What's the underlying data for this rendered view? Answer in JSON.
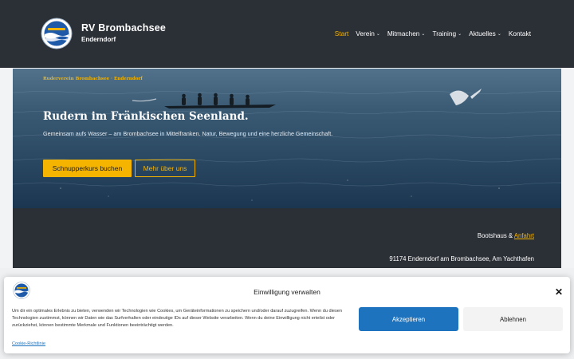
{
  "brand": {
    "name": "RV Brombachsee",
    "location": "Enderndorf"
  },
  "nav": {
    "items": [
      {
        "label": "Start",
        "active": true,
        "has_dropdown": false
      },
      {
        "label": "Verein",
        "active": false,
        "has_dropdown": true
      },
      {
        "label": "Mitmachen",
        "active": false,
        "has_dropdown": true
      },
      {
        "label": "Training",
        "active": false,
        "has_dropdown": true
      },
      {
        "label": "Aktuelles",
        "active": false,
        "has_dropdown": true
      },
      {
        "label": "Kontakt",
        "active": false,
        "has_dropdown": false
      }
    ]
  },
  "hero": {
    "kicker": "Ruderverein Brombachsee · Enderndorf",
    "title": "Rudern im Fränkischen Seenland.",
    "text": "Gemeinsam aufs Wasser – am Brombachsee in Mittelfranken. Natur, Bewegung und eine herzliche Gemeinschaft.",
    "primary_button": "Schnupperkurs buchen",
    "secondary_button": "Mehr über uns"
  },
  "info": {
    "label": "Bootshaus &",
    "link": "Anfahrt",
    "address": "91174 Enderndorf am Brombachsee, Am Yachthafen"
  },
  "consent": {
    "title": "Einwilligung verwalten",
    "text": "Um dir ein optimales Erlebnis zu bieten, verwenden wir Technologien wie Cookies, um Geräteinformationen zu speichern und/oder darauf zuzugreifen. Wenn du diesen Technologien zustimmst, können wir Daten wie das Surfverhalten oder eindeutige IDs auf dieser Website verarbeiten. Wenn du deine Einwilligung nicht erteilst oder zurückziehst, können bestimmte Merkmale und Funktionen beeinträchtigt werden.",
    "accept": "Akzeptieren",
    "deny": "Ablehnen",
    "policy_link": "Cookie-Richtlinie"
  },
  "colors": {
    "header_bg": "#2b2f36",
    "accent": "#f4b400",
    "consent_primary": "#1e73be"
  }
}
